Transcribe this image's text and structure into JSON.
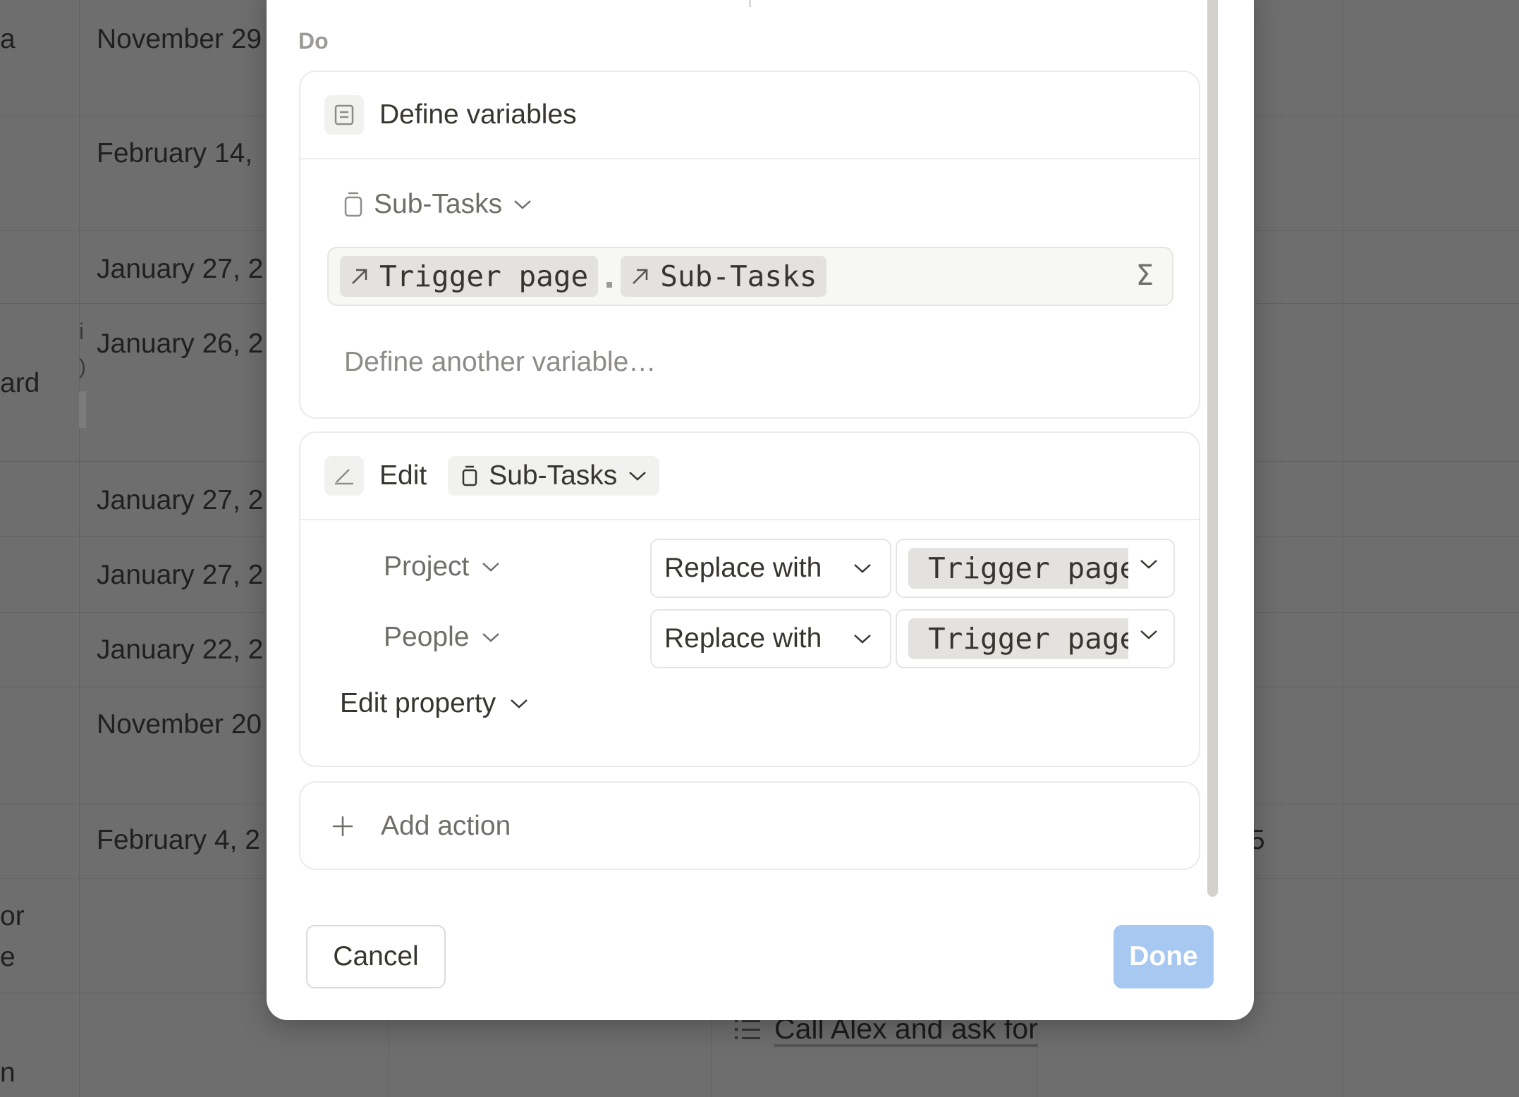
{
  "background": {
    "left_fragments": [
      "a",
      "ard",
      "or",
      "e",
      "n"
    ],
    "dates": [
      "November 29",
      "February 14,",
      "January 27, 2",
      "January 26, 2",
      "January 27, 2",
      "January 27, 2",
      "January 22, 2",
      "November 20",
      "February 4, 2"
    ],
    "misc_fragments": [
      "i",
      ")",
      ":"
    ],
    "right_fragment": "5",
    "task_title": "Call Alex and ask for"
  },
  "modal": {
    "section_label": "Do",
    "define_card": {
      "title": "Define variables",
      "variable_name": "Sub-Tasks",
      "formula_chip_1": "Trigger page",
      "formula_separator": ".",
      "formula_chip_2": "Sub-Tasks",
      "formula_icon": "Σ",
      "define_another_label": "Define another variable…"
    },
    "edit_card": {
      "action_label": "Edit",
      "target": "Sub-Tasks",
      "rows": [
        {
          "property": "Project",
          "operation": "Replace with",
          "value": "Trigger page"
        },
        {
          "property": "People",
          "operation": "Replace with",
          "value": "Trigger page"
        }
      ],
      "edit_property_label": "Edit property"
    },
    "add_action_label": "Add action",
    "cancel_label": "Cancel",
    "done_label": "Done"
  },
  "colors": {
    "done_button": "#a6c8f1",
    "overlay": "#6e6e6e",
    "chip_bg": "#e3e2df"
  }
}
